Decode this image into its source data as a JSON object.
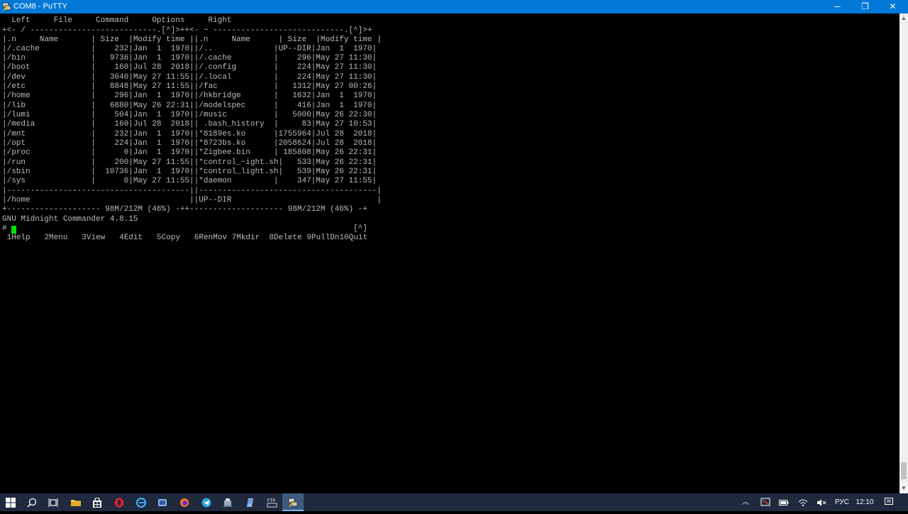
{
  "window": {
    "title": "COM8 - PuTTY"
  },
  "window_controls": {
    "minimize": "─",
    "restore": "❐",
    "close": "✕"
  },
  "terminal": {
    "lines": [
      "  Left     File     Command     Options     Right",
      "+<- / ---------------------------.[^]>++<- ~ ----------------------------.[^]>+",
      "|.n     Name       | Size  |Modify time ||.n     Name      | Size  |Modify time |",
      "|/.cache           |    232|Jan  1  1970||/..             |UP--DIR|Jan  1  1970|",
      "|/bin              |   9736|Jan  1  1970||/.cache         |    296|May 27 11:30|",
      "|/boot             |    160|Jul 28  2018||/.config        |    224|May 27 11:30|",
      "|/dev              |   3040|May 27 11:55||/.local         |    224|May 27 11:30|",
      "|/etc              |   8848|May 27 11:55||/fac            |   1312|May 27 00:26|",
      "|/home             |    296|Jan  1  1970||/hkbridge       |   1632|Jan  1  1970|",
      "|/lib              |   6880|May 26 22:31||/modelspec      |    416|Jan  1  1970|",
      "|/lumi             |    504|Jan  1  1970||/music          |   5000|May 26 22:30|",
      "|/media            |    160|Jul 28  2018|| .bash_history  |     83|May 27 10:53|",
      "|/mnt              |    232|Jan  1  1970||*8189es.ko      |1755964|Jul 28  2018|",
      "|/opt              |    224|Jan  1  1970||*8723bs.ko      |2058624|Jul 28  2018|",
      "|/proc             |      0|Jan  1  1970||*Zigbee.bin     | 185808|May 26 22:31|",
      "|/run              |    200|May 27 11:55||*control_~ight.sh|   533|May 26 22:31|",
      "|/sbin             |  10736|Jan  1  1970||*control_light.sh|   539|May 26 22:31|",
      "|/sys              |      0|May 27 11:55||*daemon         |    347|May 27 11:55|",
      "|---------------------------------------||--------------------------------------|",
      "|/home                                  ||UP--DIR                               |",
      "+-------------------- 98M/212M (46%) -++-------------------- 98M/212M (46%) -+",
      "GNU Midnight Commander 4.8.15",
      "#                                                                          [^]"
    ],
    "fkeys": [
      {
        "num": "1",
        "label": "Help"
      },
      {
        "num": "2",
        "label": "Menu"
      },
      {
        "num": "3",
        "label": "View"
      },
      {
        "num": "4",
        "label": "Edit"
      },
      {
        "num": "5",
        "label": "Copy"
      },
      {
        "num": "6",
        "label": "RenMov"
      },
      {
        "num": "7",
        "label": "Mkdir"
      },
      {
        "num": "8",
        "label": "Delete"
      },
      {
        "num": "9",
        "label": "PullDn"
      },
      {
        "num": "10",
        "label": "Quit"
      }
    ]
  },
  "taskbar": {
    "language": "РУС",
    "time": "12:10",
    "ftp_label": "FTP"
  },
  "colors": {
    "titlebar": "#0078d7",
    "terminal_fg": "#bbbbbb",
    "cursor": "#00e400",
    "taskbar": "#1f2a3e"
  }
}
